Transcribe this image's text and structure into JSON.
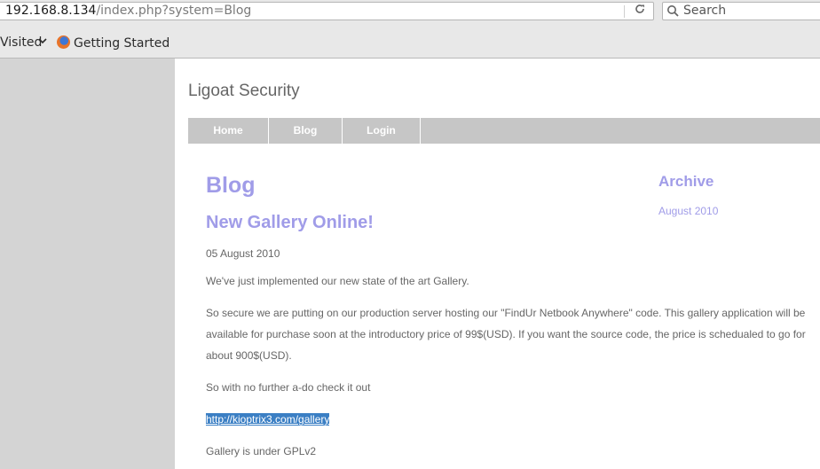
{
  "browser": {
    "url_host": "192.168.8.134",
    "url_path": "/index.php?system=Blog",
    "search_placeholder": "Search",
    "bookmarks": {
      "visited": "Visited",
      "getting_started": "Getting Started"
    }
  },
  "site": {
    "title": "Ligoat Security",
    "nav": [
      "Home",
      "Blog",
      "Login"
    ]
  },
  "blog": {
    "heading": "Blog",
    "post_title": "New Gallery Online!",
    "date": "05 August 2010",
    "p1": "We've just implemented our new state of the art Gallery.",
    "p2_lines": [
      "So secure we are putting on our production server hosting our \"FindUr Netbook Anywhere\" code. This gallery application will be",
      "available for purchase soon at the introductory price of 99$(USD). If you want the source code, the price is schedualed to go for",
      "about 900$(USD)."
    ],
    "p3": "So with no further a-do check it out",
    "link": "http://kioptrix3.com/gallery",
    "p4": "Gallery is under GPLv2"
  },
  "sidebar": {
    "archive_heading": "Archive",
    "archive_link": "August 2010"
  }
}
